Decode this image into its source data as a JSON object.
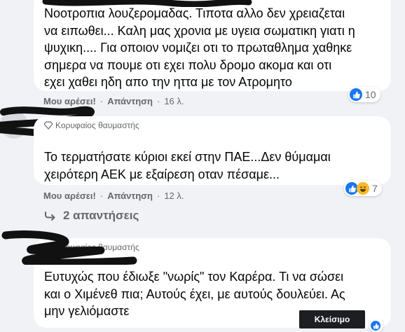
{
  "comments": [
    {
      "text": "Νοοτροπια λουζερομαδας. Τιποτα αλλο δεν χρειαζεται\nνα ειπωθει... Καλη μας χρονια με υγεια σωματικη γιατι η\nψυχικη.... Για οποιον νομιζει οτι το πρωταθλημα χαθηκε\nσημερα να πουμε οτι εχει πολυ δρομο ακομα και οτι\nεχει χαθει ηδη απο την ηττα με τον Ατρομητο",
      "like_label": "Μου αρέσει!",
      "reply_label": "Απάντηση",
      "separator": "·",
      "time": "16 λ.",
      "reaction_count": "10"
    },
    {
      "badge": "Κορυφαίος θαυμαστής",
      "text": "Το τερματήσατε κύριοι εκεί στην ΠΑΕ...Δεν θύμαμαι\nχειρότερη ΑΕΚ με εξαίρεση οταν πέσαμε...",
      "like_label": "Μου αρέσει!",
      "reply_label": "Απάντηση",
      "separator": "·",
      "time": "12 λ.",
      "reaction_count": "7",
      "replies_link": "2 απαντήσεις"
    },
    {
      "badge": "Κορυφαίος θαυμαστής",
      "text": "Ευτυχώς που έδιωξε \"νωρίς\" τον Καρέρα. Τι να σώσει\nκαι ο Χιμένεθ πια; Αυτούς έχει, με αυτούς δουλεύει. Ας\nμην γελιόμαστε"
    }
  ],
  "close_button": "Κλείσιμο",
  "icons": {
    "like": "like-icon",
    "haha": "haha-icon",
    "badge": "diamond-icon",
    "reply_arrow": "reply-arrow-icon"
  },
  "colors": {
    "background": "#f0f2f5",
    "bubble": "#ffffff",
    "meta": "#65676b",
    "like_blue": "#1877f2",
    "haha_yellow": "#f7b928"
  }
}
